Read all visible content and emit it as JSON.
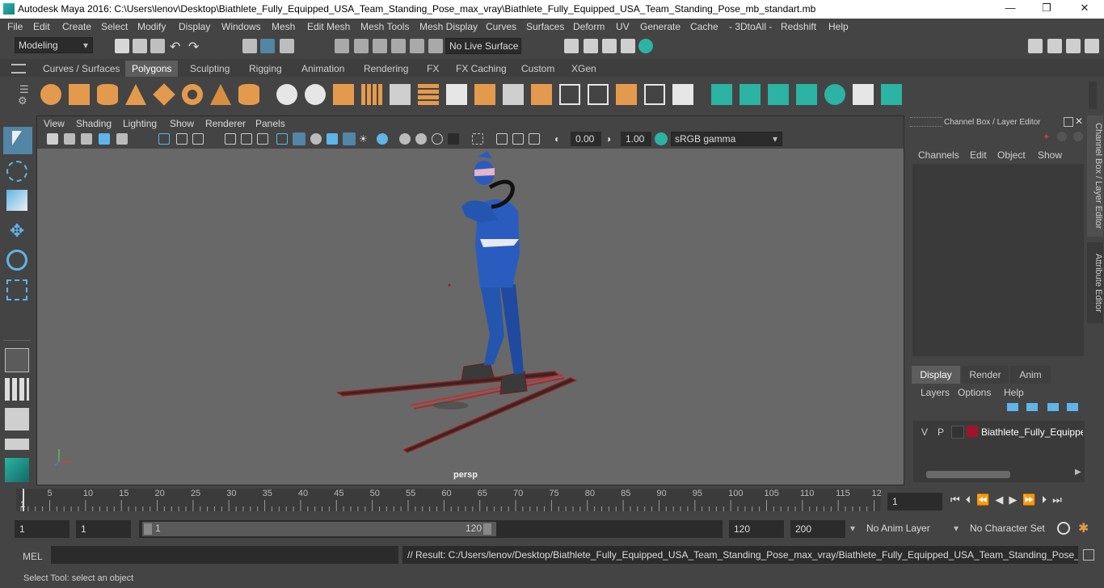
{
  "window": {
    "title": "Autodesk Maya 2016: C:\\Users\\lenov\\Desktop\\Biathlete_Fully_Equipped_USA_Team_Standing_Pose_max_vray\\Biathlete_Fully_Equipped_USA_Team_Standing_Pose_mb_standart.mb"
  },
  "menubar": {
    "items": [
      "File",
      "Edit",
      "Create",
      "Select",
      "Modify",
      "Display",
      "Windows",
      "Mesh",
      "Edit Mesh",
      "Mesh Tools",
      "Mesh Display",
      "Curves",
      "Surfaces",
      "Deform",
      "UV",
      "Generate",
      "Cache",
      "- 3DtoAll -",
      "Redshift",
      "Help"
    ]
  },
  "statusline": {
    "mode": "Modeling",
    "live_surface": "No Live Surface"
  },
  "shelf": {
    "tabs": [
      "Curves / Surfaces",
      "Polygons",
      "Sculpting",
      "Rigging",
      "Animation",
      "Rendering",
      "FX",
      "FX Caching",
      "Custom",
      "XGen"
    ],
    "active_tab": "Polygons"
  },
  "viewport": {
    "menu": [
      "View",
      "Shading",
      "Lighting",
      "Show",
      "Renderer",
      "Panels"
    ],
    "exposure": "0.00",
    "gamma": "1.00",
    "colorspace": "sRGB gamma",
    "camera_label": "persp"
  },
  "channel_box": {
    "title": "Channel Box / Layer Editor",
    "menu": [
      "Channels",
      "Edit",
      "Object",
      "Show"
    ]
  },
  "layer_editor": {
    "tabs": [
      "Display",
      "Render",
      "Anim"
    ],
    "active_tab": "Display",
    "menu": [
      "Layers",
      "Options",
      "Help"
    ],
    "layers": [
      {
        "v": "V",
        "p": "P",
        "name": "Biathlete_Fully_Equipped",
        "color": "#a0142a"
      }
    ]
  },
  "side_tabs": {
    "channel_box": "Channel Box / Layer Editor",
    "attribute_editor": "Attribute Editor"
  },
  "timeline": {
    "ticks": [
      "5",
      "10",
      "15",
      "20",
      "25",
      "30",
      "35",
      "40",
      "45",
      "50",
      "55",
      "60",
      "65",
      "70",
      "75",
      "80",
      "85",
      "90",
      "95",
      "100",
      "105",
      "110",
      "115",
      "12"
    ],
    "start_label": "1",
    "current_frame": "1"
  },
  "range": {
    "start": "1",
    "playback_start": "1",
    "slider_start": "1",
    "slider_end": "120",
    "playback_end": "120",
    "end": "200",
    "anim_layer": "No Anim Layer",
    "character_set": "No Character Set"
  },
  "commandline": {
    "label": "MEL",
    "result": "// Result: C:/Users/lenov/Desktop/Biathlete_Fully_Equipped_USA_Team_Standing_Pose_max_vray/Biathlete_Fully_Equipped_USA_Team_Standing_Pose_mb_standar"
  },
  "helpline": {
    "text": "Select Tool: select an object"
  },
  "colors": {
    "accent_orange": "#e49a4c",
    "accent_teal": "#2bb3a3",
    "selected_blue": "#5285a6"
  }
}
